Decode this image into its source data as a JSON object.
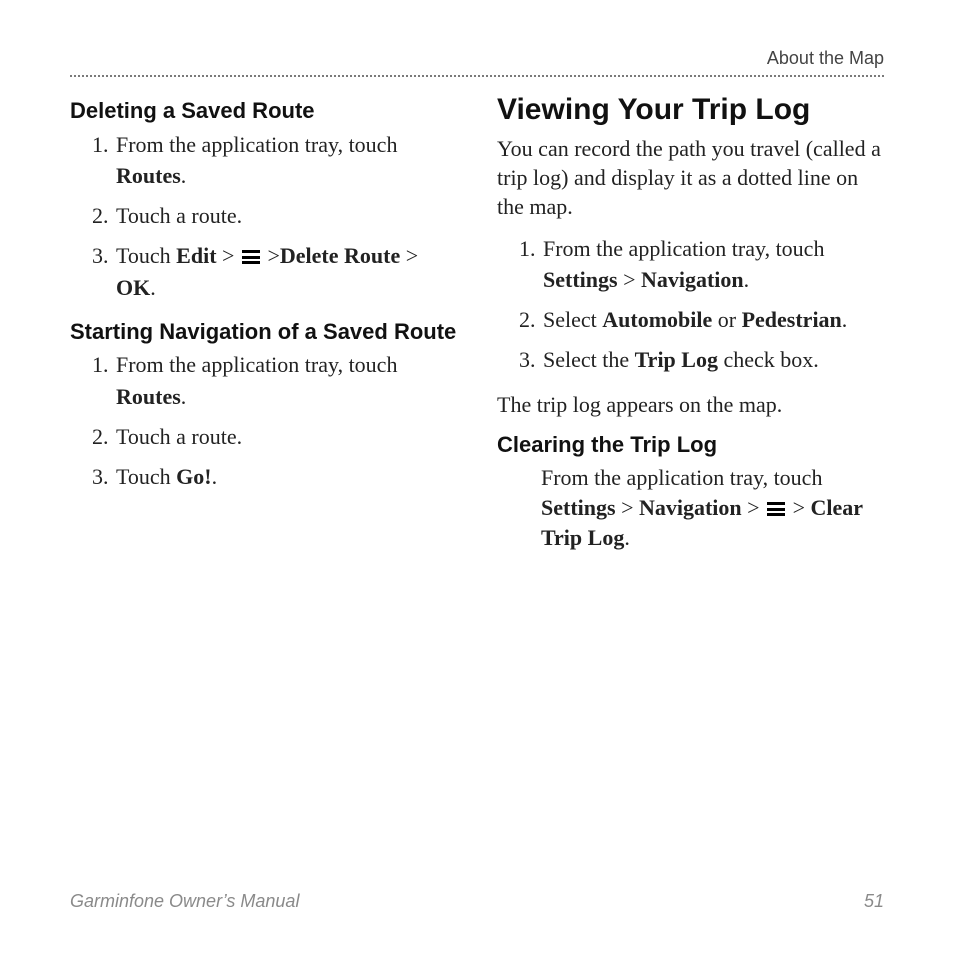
{
  "running_head": "About the Map",
  "footer": {
    "title": "Garminfone Owner’s Manual",
    "page": "51"
  },
  "left": {
    "sec1": {
      "heading": "Deleting a Saved Route",
      "step1_a": "From the application tray, touch ",
      "step1_b": "Routes",
      "step1_c": ".",
      "step2": "Touch a route.",
      "step3_a": "Touch ",
      "step3_edit": "Edit",
      "step3_b": " > ",
      "step3_c": " >",
      "step3_delete": "Delete Route",
      "step3_d": " > ",
      "step3_ok": "OK",
      "step3_e": "."
    },
    "sec2": {
      "heading": "Starting Navigation of a Saved Route",
      "step1_a": "From the application tray, touch ",
      "step1_b": "Routes",
      "step1_c": ".",
      "step2": "Touch a route.",
      "step3_a": "Touch ",
      "step3_go": "Go!",
      "step3_b": "."
    }
  },
  "right": {
    "heading": "Viewing Your Trip Log",
    "intro": "You can record the path you travel (called a trip log) and display it as a dotted line on the map.",
    "step1_a": "From the application tray, touch ",
    "step1_settings": "Settings",
    "step1_b": " > ",
    "step1_nav": "Navigation",
    "step1_c": ".",
    "step2_a": "Select ",
    "step2_auto": "Automobile",
    "step2_b": " or ",
    "step2_ped": "Pedestrian",
    "step2_c": ".",
    "step3_a": "Select the ",
    "step3_trip": "Trip Log",
    "step3_b": " check box.",
    "after": "The trip log appears on the map.",
    "sec2": {
      "heading": "Clearing the Trip Log",
      "line_a": "From the application tray, touch ",
      "line_settings": "Settings",
      "line_b": " > ",
      "line_nav": "Navigation",
      "line_c": " > ",
      "line_d": " > ",
      "line_clear": "Clear Trip Log",
      "line_e": "."
    }
  }
}
